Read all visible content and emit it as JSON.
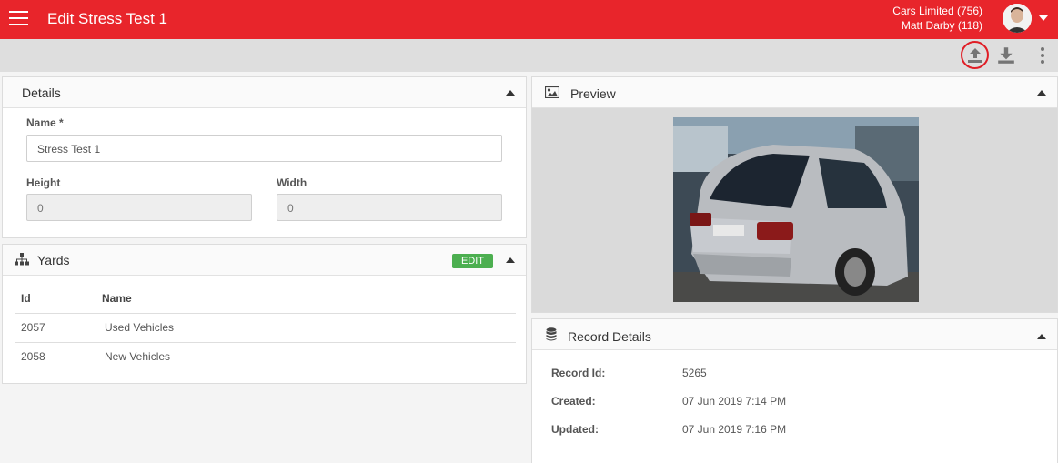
{
  "header": {
    "title": "Edit Stress Test 1",
    "company": "Cars Limited (756)",
    "user": "Matt Darby (118)"
  },
  "toolbar": {
    "upload_icon": "upload-icon",
    "download_icon": "download-icon",
    "more_icon": "more-vert-icon"
  },
  "details": {
    "title": "Details",
    "name_label": "Name *",
    "name_value": "Stress Test 1",
    "height_label": "Height",
    "height_value": "0",
    "width_label": "Width",
    "width_value": "0"
  },
  "yards": {
    "title": "Yards",
    "edit_label": "EDIT",
    "columns": [
      "Id",
      "Name"
    ],
    "rows": [
      {
        "id": "2057",
        "name": "Used Vehicles"
      },
      {
        "id": "2058",
        "name": "New Vehicles"
      }
    ]
  },
  "preview": {
    "title": "Preview"
  },
  "record": {
    "title": "Record Details",
    "id_label": "Record Id:",
    "id_value": "5265",
    "created_label": "Created:",
    "created_value": "07 Jun 2019 7:14 PM",
    "updated_label": "Updated:",
    "updated_value": "07 Jun 2019 7:16 PM"
  },
  "colors": {
    "brand": "#e8252b",
    "accent_green": "#4caf50"
  }
}
